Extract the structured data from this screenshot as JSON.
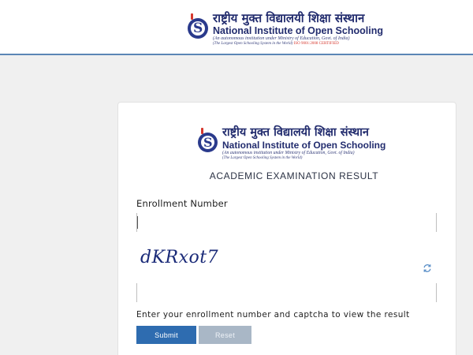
{
  "header": {
    "logo": {
      "hindi": "राष्ट्रीय मुक्त विद्यालयी शिक्षा संस्थान",
      "english": "National Institute of Open Schooling",
      "subtitle": "(An autonomous institution under Ministry of Education, Govt. of India)",
      "tagline": "(The Largest Open Schooling System in the World)",
      "certification": "ISO 9001:2008 CERTIFIED",
      "emblem_letter": "S"
    }
  },
  "card": {
    "logo": {
      "hindi": "राष्ट्रीय मुक्त विद्यालयी शिक्षा संस्थान",
      "english": "National Institute of Open Schooling",
      "subtitle": "(An autonomous institution under Ministry of Education, Govt. of India)",
      "tagline": "(The Largest Open Schooling System in the World)",
      "emblem_letter": "S"
    },
    "heading": "ACADEMIC EXAMINATION RESULT",
    "enrollment": {
      "label": "Enrollment Number",
      "value": "",
      "placeholder": ""
    },
    "captcha": {
      "text": "dKRxot7",
      "input_value": "",
      "input_placeholder": "",
      "refresh_icon": "refresh-icon"
    },
    "hint": "Enter your enrollment number and captcha to view the result",
    "buttons": {
      "submit": "Submit",
      "reset": "Reset"
    }
  },
  "colors": {
    "header_border": "#5b86b5",
    "brand_blue": "#222c6e",
    "accent_red": "#d6382e",
    "submit_bg": "#2e6cb0",
    "reset_bg": "#a9b7c6",
    "page_bg": "#f0f0f0"
  }
}
